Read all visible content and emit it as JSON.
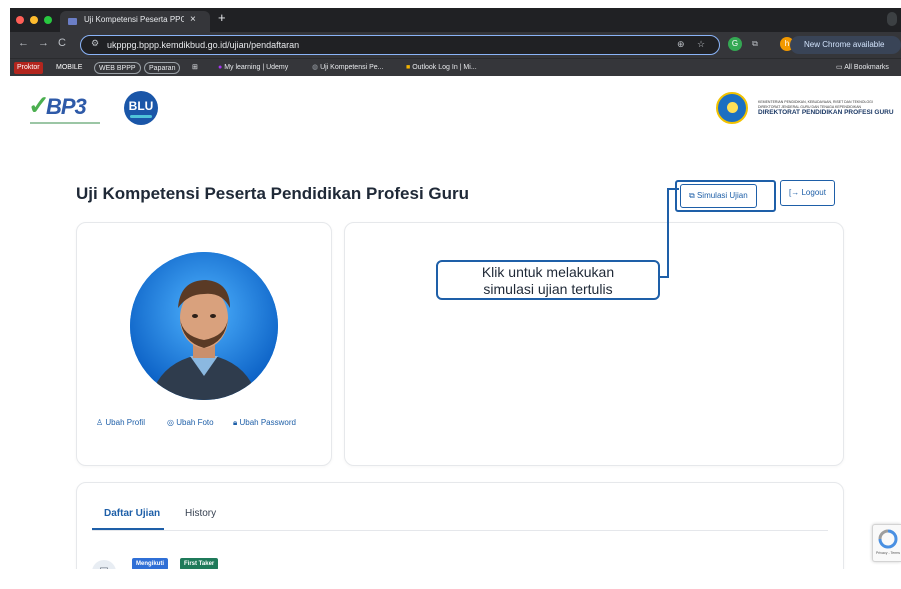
{
  "browser": {
    "tab_title": "Uji Kompetensi Peserta PPG",
    "tab_close": "×",
    "new_tab": "+",
    "nav_back": "←",
    "nav_forward": "→",
    "nav_reload": "C",
    "url": "ukpppg.bppp.kemdikbud.go.id/ujian/pendaftaran",
    "profile_initial": "h",
    "update_notice": "New Chrome available"
  },
  "bookmarks": {
    "items": [
      "Proktor",
      "MOBILE",
      "WEB BPPP",
      "Paparan",
      "My learning | Udemy",
      "Uji Kompetensi Pe...",
      "Outlook Log In | Mi..."
    ],
    "all_bookmarks": "All Bookmarks"
  },
  "header": {
    "logo_left": "BP3",
    "logo_blu": "BLU",
    "ministry_line1": "KEMENTERIAN PENDIDIKAN, KEBUDAYAAN, RISET DAN TEKNOLOGI",
    "ministry_line2": "DIREKTORAT JENDERAL GURU DAN TENAGA KEPENDIDIKAN",
    "ministry_main": "DIREKTORAT PENDIDIKAN PROFESI GURU"
  },
  "main": {
    "title": "Uji Kompetensi Peserta Pendidikan Profesi Guru",
    "simulasi_button": "Simulasi Ujian",
    "logout_button": "Logout"
  },
  "profile": {
    "ubah_profil": "Ubah Profil",
    "ubah_foto": "Ubah Foto",
    "ubah_password": "Ubah Password"
  },
  "callout": {
    "line1": "Klik untuk melakukan",
    "line2": "simulasi ujian tertulis"
  },
  "tabs": {
    "daftar_ujian": "Daftar Ujian",
    "history": "History"
  },
  "badges": {
    "mengikuti": "Mengikuti",
    "first_taker": "First Taker"
  },
  "recaptcha": {
    "label": "Privacy - Terms"
  },
  "colors": {
    "accent": "#1e5fa8",
    "badge_blue": "#2f6fd6",
    "badge_green": "#1f7a5a"
  }
}
